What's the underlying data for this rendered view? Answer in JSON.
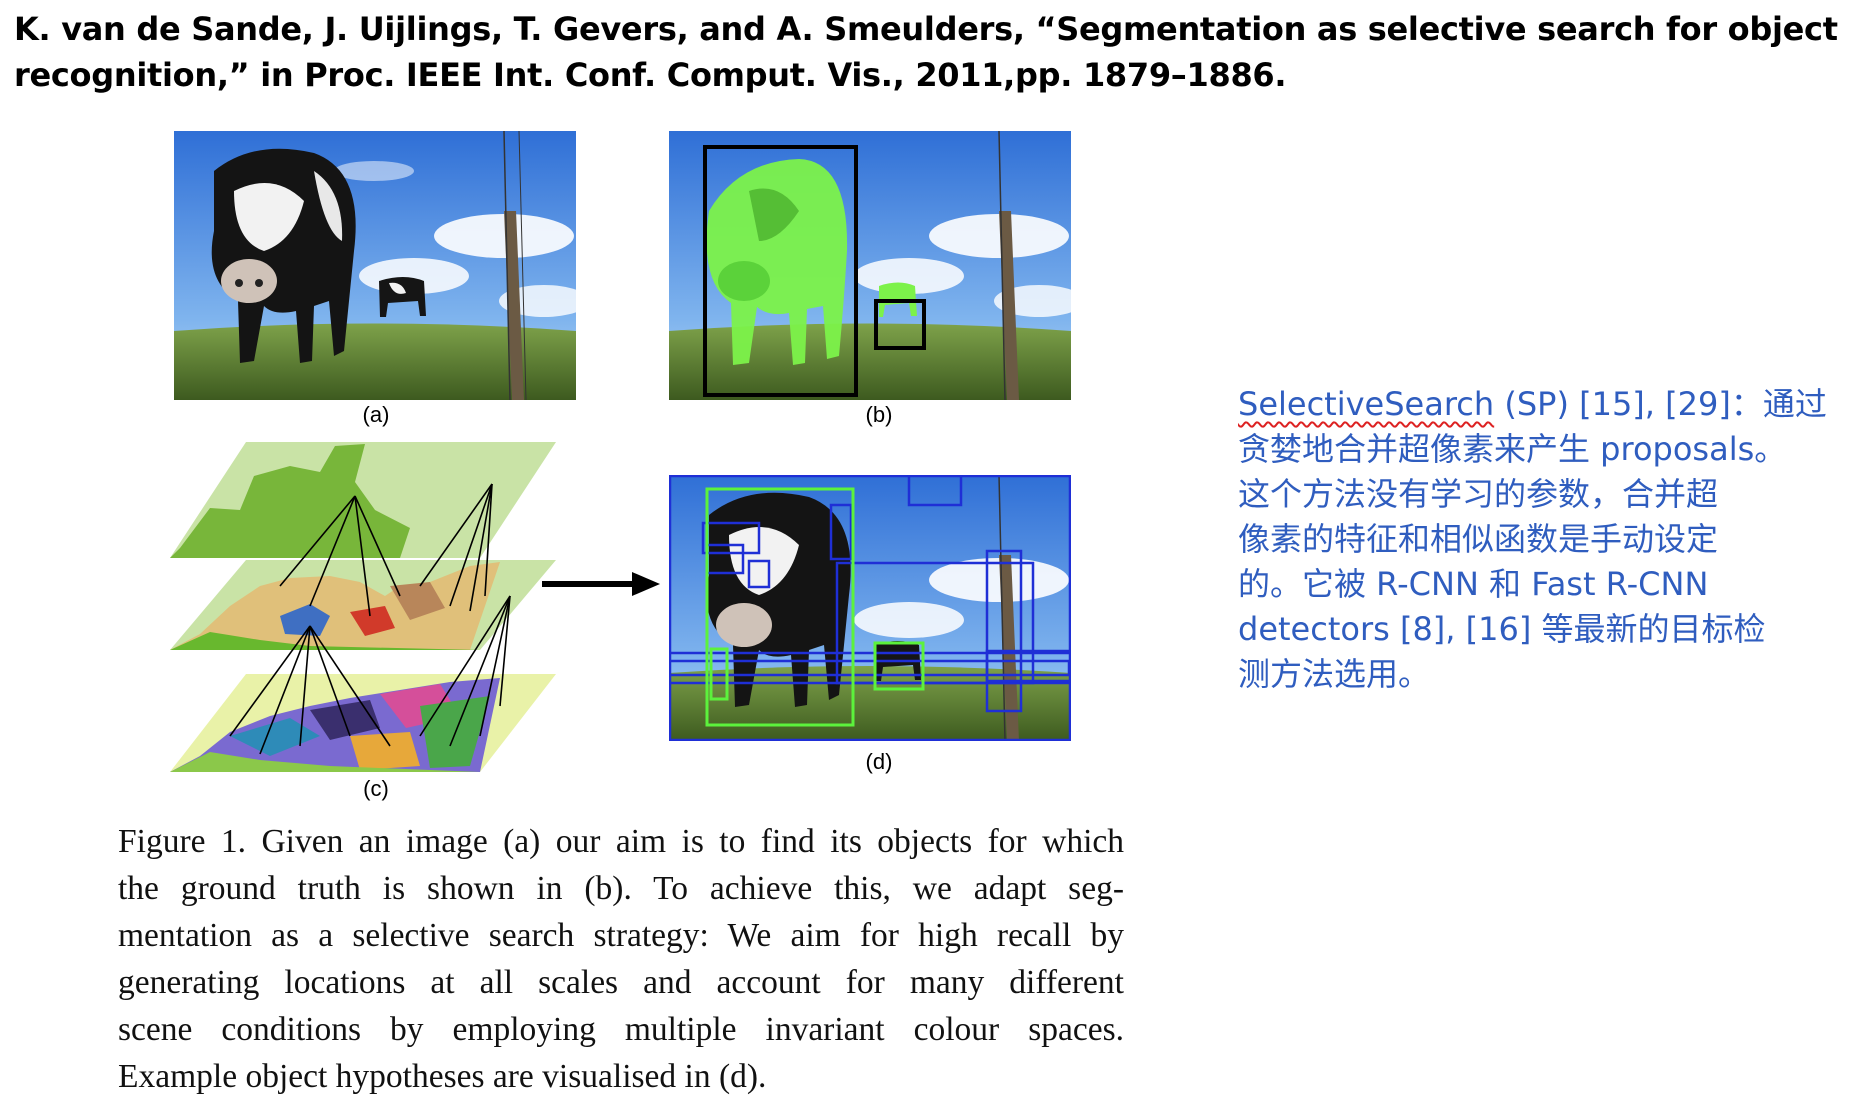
{
  "reference": {
    "line1": "K. van de Sande, J. Uijlings, T. Gevers, and A. Smeulders,   “Segmentation as selective search for object",
    "line2": "recognition,”   in Proc. IEEE Int. Conf. Comput. Vis., 2011,pp. 1879–1886."
  },
  "figure": {
    "labels": {
      "a": "(a)",
      "b": "(b)",
      "c": "(c)",
      "d": "(d)"
    }
  },
  "caption": {
    "lines": [
      "Figure 1. Given an image (a) our aim is to find its objects for which",
      "the ground truth is shown in (b).  To achieve this, we adapt seg-",
      "mentation as a selective search strategy: We aim for high recall by",
      "generating locations at all scales and account for many different",
      "scene conditions by employing multiple invariant colour spaces.",
      "Example object hypotheses are visualised in (d)."
    ]
  },
  "note": {
    "term": "SelectiveSearch",
    "line1_rest": " (SP) [15], [29]：通过",
    "lines": [
      "贪婪地合并超像素来产生 proposals。",
      "这个方法没有学习的参数，合并超",
      "像素的特征和相似函数是手动设定",
      "的。它被 R-CNN 和 Fast R-CNN",
      "detectors [8], [16] 等最新的目标检",
      "测方法选用。"
    ]
  },
  "colors": {
    "note_text": "#2f5dbf",
    "ground_truth_box": "#000000",
    "ground_truth_mask": "#7cf24a",
    "hypothesis_box_blue": "#1f2fd6",
    "hypothesis_box_green": "#5cf23c"
  }
}
